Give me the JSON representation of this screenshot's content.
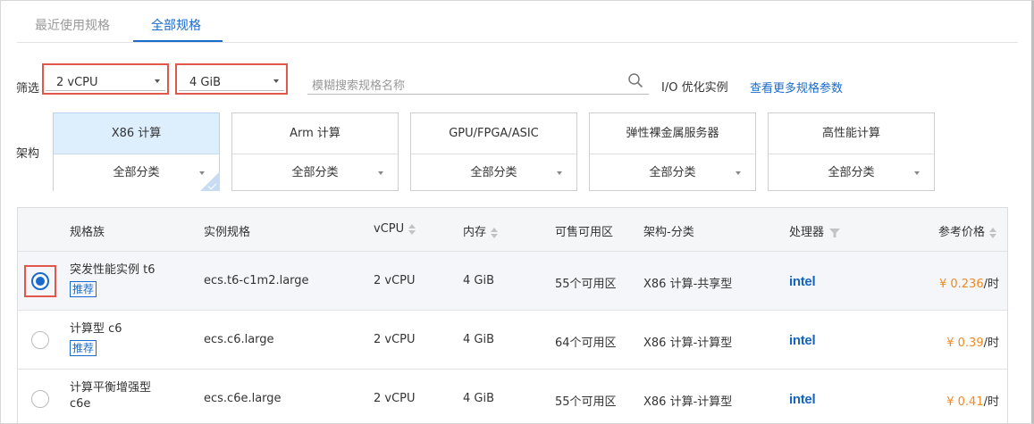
{
  "tabs": [
    {
      "label": "最近使用规格",
      "active": false
    },
    {
      "label": "全部规格",
      "active": true
    }
  ],
  "filters": {
    "label": "筛选",
    "vcpu": "2 vCPU",
    "memory": "4 GiB",
    "search_placeholder": "模糊搜索规格名称",
    "io_label": "I/O 优化实例",
    "more_link": "查看更多规格参数"
  },
  "arch": {
    "label": "架构",
    "cards": [
      {
        "title": "X86 计算",
        "sub": "全部分类",
        "active": true
      },
      {
        "title": "Arm 计算",
        "sub": "全部分类",
        "active": false
      },
      {
        "title": "GPU/FPGA/ASIC",
        "sub": "全部分类",
        "active": false
      },
      {
        "title": "弹性裸金属服务器",
        "sub": "全部分类",
        "active": false
      },
      {
        "title": "高性能计算",
        "sub": "全部分类",
        "active": false
      }
    ]
  },
  "table": {
    "headers": {
      "family": "规格族",
      "spec": "实例规格",
      "vcpu": "vCPU",
      "memory": "内存",
      "zones": "可售可用区",
      "arch": "架构-分类",
      "cpu": "处理器",
      "price": "参考价格"
    },
    "rows": [
      {
        "family": "突发性能实例 t6",
        "badge": "推荐",
        "spec": "ecs.t6-c1m2.large",
        "vcpu": "2 vCPU",
        "memory": "4 GiB",
        "zones": "55个可用区",
        "arch": "X86 计算-共享型",
        "cpu": "intel",
        "price": "¥ 0.236",
        "unit": "/时",
        "selected": true
      },
      {
        "family": "计算型 c6",
        "badge": "推荐",
        "spec": "ecs.c6.large",
        "vcpu": "2 vCPU",
        "memory": "4 GiB",
        "zones": "64个可用区",
        "arch": "X86 计算-计算型",
        "cpu": "intel",
        "price": "¥ 0.39",
        "unit": "/时",
        "selected": false
      },
      {
        "family": "计算平衡增强型",
        "family2": "c6e",
        "spec": "ecs.c6e.large",
        "vcpu": "2 vCPU",
        "memory": "4 GiB",
        "zones": "55个可用区",
        "arch": "X86 计算-计算型",
        "cpu": "intel",
        "price": "¥ 0.41",
        "unit": "/时",
        "selected": false
      }
    ]
  },
  "colors": {
    "accent": "#1a6bcc",
    "highlight": "#e2574c",
    "price": "#f08a24"
  }
}
